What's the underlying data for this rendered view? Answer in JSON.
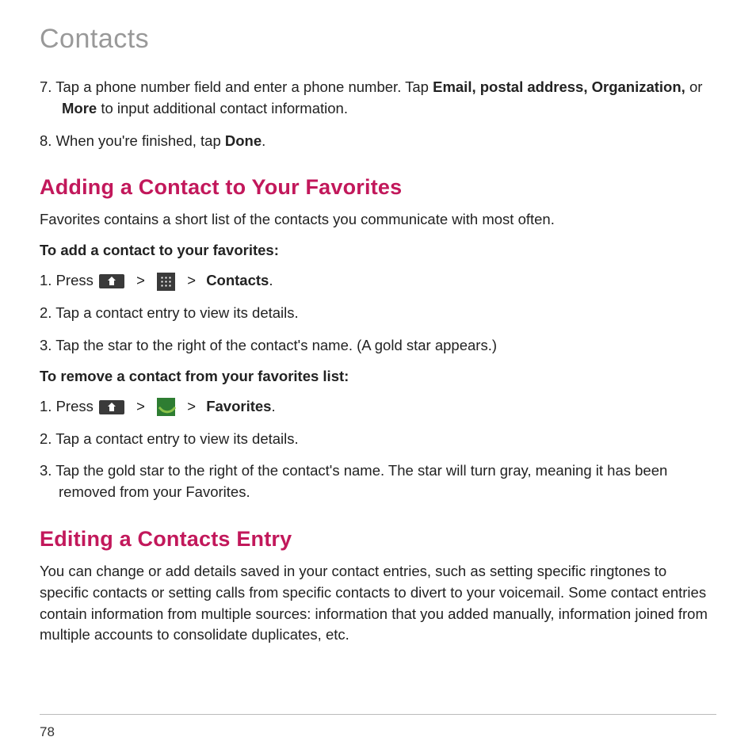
{
  "pageTitle": "Contacts",
  "step7_a": "7.  Tap a phone number field and enter a phone number. Tap ",
  "step7_b1": "Email, postal address, Organization,",
  "step7_c": " or ",
  "step7_b2": "More",
  "step7_d": " to input additional contact information.",
  "step8_a": "8. When you're finished, tap ",
  "step8_b": "Done",
  "step8_c": ".",
  "heading1": "Adding a Contact to Your Favorites",
  "intro1": "Favorites contains a short list of the contacts you communicate with most often.",
  "sub1": "To add a contact to your favorites:",
  "add1_a": "1. Press ",
  "gt": " > ",
  "add1_b": "Contacts",
  "punct_dot": ".",
  "add2": "2. Tap a contact entry to view its details.",
  "add3": "3. Tap the star to the right of the contact's name. (A gold star appears.)",
  "sub2": "To remove a contact from your favorites list:",
  "rem1_a": "1. Press ",
  "rem1_b": "Favorites",
  "rem2": "2. Tap a contact entry to view its details.",
  "rem3": "3. Tap the gold star to the right of the contact's name. The star will turn gray, meaning it has been removed from your Favorites.",
  "heading2": "Editing a Contacts Entry",
  "intro2": "You can change or add details saved in your contact entries, such as setting specific ringtones to specific contacts or setting calls from specific contacts to divert to your voicemail. Some contact entries contain information from multiple sources: information that you added manually, information joined from multiple accounts to consolidate duplicates, etc.",
  "pageNumber": "78"
}
